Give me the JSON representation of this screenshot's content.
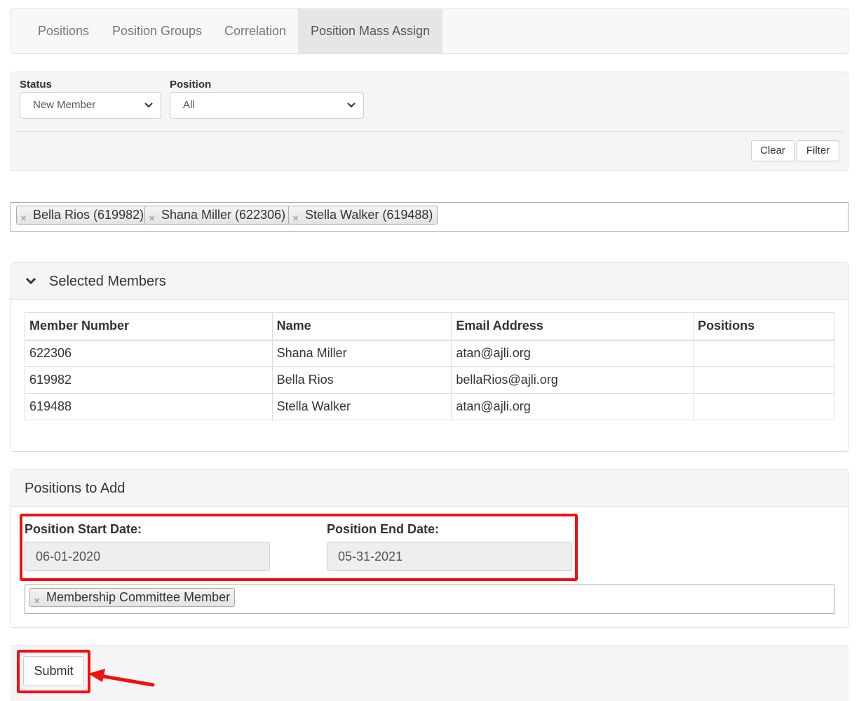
{
  "tabs": [
    {
      "label": "Positions"
    },
    {
      "label": "Position Groups"
    },
    {
      "label": "Correlation"
    },
    {
      "label": "Position Mass Assign"
    }
  ],
  "filter": {
    "status_label": "Status",
    "status_value": "New Member",
    "position_label": "Position",
    "position_value": "All",
    "clear_label": "Clear",
    "filter_label": "Filter"
  },
  "member_tokens": [
    {
      "label": "Bella Rios (619982)"
    },
    {
      "label": "Shana Miller (622306)"
    },
    {
      "label": "Stella Walker (619488)"
    }
  ],
  "selected_members": {
    "title": "Selected Members",
    "columns": [
      "Member Number",
      "Name",
      "Email Address",
      "Positions"
    ],
    "rows": [
      [
        "622306",
        "Shana Miller",
        "atan@ajli.org",
        ""
      ],
      [
        "619982",
        "Bella Rios",
        "bellaRios@ajli.org",
        ""
      ],
      [
        "619488",
        "Stella Walker",
        "atan@ajli.org",
        ""
      ]
    ]
  },
  "positions_to_add": {
    "title": "Positions to Add",
    "start_label": "Position Start Date:",
    "start_value": "06-01-2020",
    "end_label": "Position End Date:",
    "end_value": "05-31-2021",
    "position_tokens": [
      {
        "label": "Membership Committee Member"
      }
    ]
  },
  "submit_label": "Submit",
  "colors": {
    "highlight": "#ee1111",
    "active_tab": "#e6e6e6"
  }
}
